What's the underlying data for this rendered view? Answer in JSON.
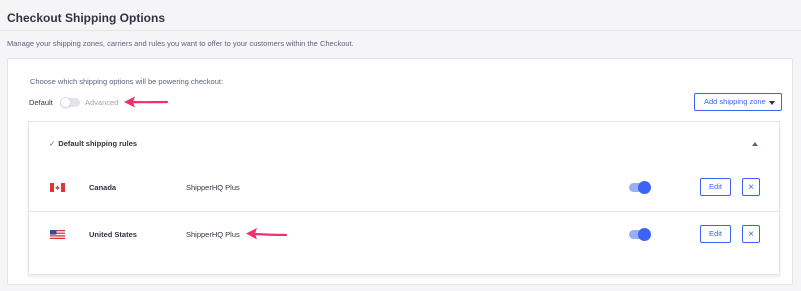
{
  "header": {
    "title": "Checkout Shipping Options",
    "subtitle": "Manage your shipping zones, carriers and rules you want to offer to your customers within the Checkout."
  },
  "options": {
    "prompt": "Choose which shipping options will be powering checkout:",
    "default_label": "Default",
    "advanced_label": "Advanced",
    "mode_toggle_on": false,
    "add_zone_label": "Add shipping zone"
  },
  "rules": {
    "heading": "Default shipping rules",
    "check_glyph": "✓",
    "rows": [
      {
        "flag": "canada-flag-icon",
        "country": "Canada",
        "carrier": "ShipperHQ Plus",
        "enabled": true,
        "edit_label": "Edit",
        "delete_glyph": "×"
      },
      {
        "flag": "us-flag-icon",
        "country": "United States",
        "carrier": "ShipperHQ Plus",
        "enabled": true,
        "edit_label": "Edit",
        "delete_glyph": "×"
      }
    ]
  },
  "colors": {
    "accent": "#3c64f4",
    "annotation_arrow": "#f0306e"
  }
}
